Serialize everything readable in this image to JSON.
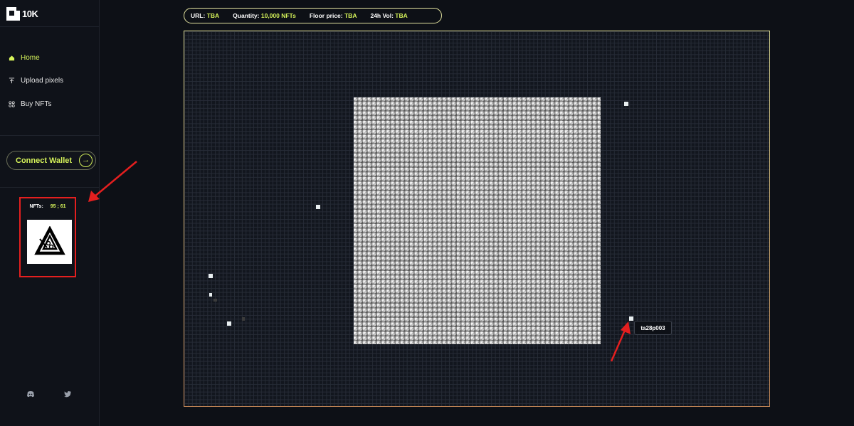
{
  "app": {
    "name": "10K"
  },
  "sidebar": {
    "items": [
      {
        "label": "Home",
        "icon": "home-icon",
        "active": true
      },
      {
        "label": "Upload pixels",
        "icon": "upload-icon",
        "active": false
      },
      {
        "label": "Buy NFTs",
        "icon": "grid-icon",
        "active": false
      }
    ],
    "connect_wallet_label": "Connect Wallet",
    "nft_panel": {
      "label": "NFTs:",
      "coords": "95 ; 61"
    },
    "social": [
      "discord-icon",
      "twitter-icon"
    ]
  },
  "stats": {
    "url_label": "URL:",
    "url_value": "TBA",
    "quantity_label": "Quantity:",
    "quantity_value": "10,000 NFTs",
    "floor_label": "Floor price:",
    "floor_value": "TBA",
    "vol_label": "24h Vol:",
    "vol_value": "TBA"
  },
  "canvas": {
    "tooltip": "ta28p003"
  },
  "colors": {
    "accent": "#d6f35a",
    "background": "#0d1016",
    "annotation": "#e41f1f"
  }
}
